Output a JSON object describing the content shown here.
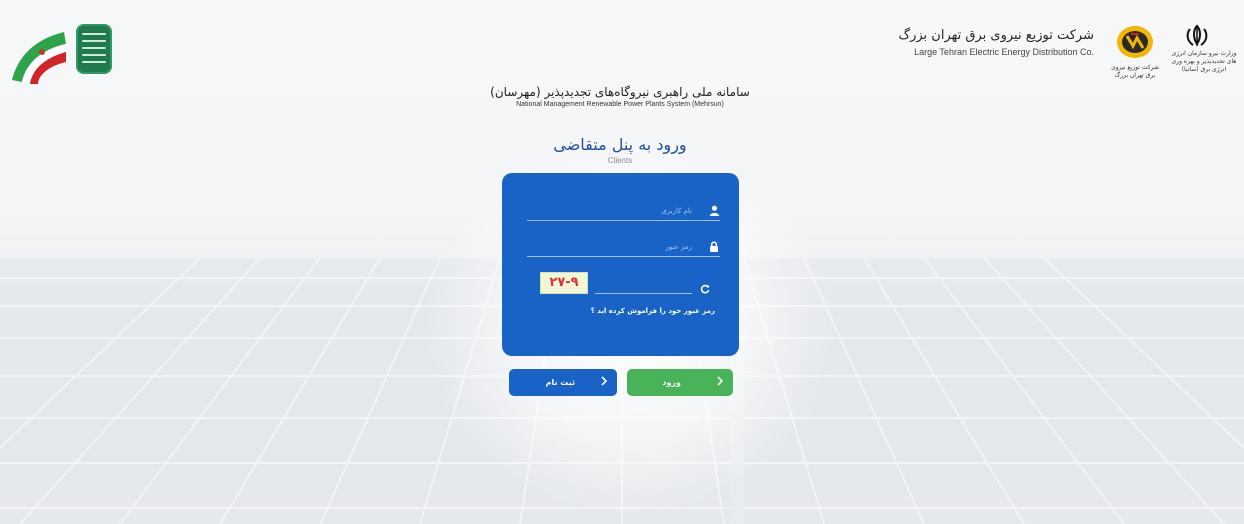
{
  "header": {
    "company_name_fa": "شرکت توزیع نیروی برق تهران بزرگ",
    "company_name_en": "Large Tehran Electric Energy Distribution Co.",
    "company_logo_caption": "شرکت توزیع نیروی برق تهران بزرگ",
    "ministry_caption": "وزارت نیرو سازمان انرژی های تجدیدپذیر و بهره وری انرژی برق (ساتبا)"
  },
  "system": {
    "title_fa": "سامانه ملی راهبری نیروگاه‌های تجدیدپذیر (مهرسان)",
    "title_en": "National Management Renewable Power Plants System (Mehrsun)"
  },
  "login": {
    "title_fa": "ورود به پنل متقاضی",
    "subtitle_en": "Clients",
    "username_placeholder": "نام کاربری",
    "password_placeholder": "رمز عبور",
    "captcha_text": "۲۷-۹",
    "forgot_link": "رمز عبور خود را فراموش کرده اید ؟",
    "login_button": "ورود",
    "register_button": "ثبت نام"
  },
  "icons": {
    "username": "user-icon",
    "password": "lock-icon",
    "captcha_refresh": "refresh-icon",
    "button_chevron": "chevron-right-icon"
  },
  "colors": {
    "card_blue": "#1963c7",
    "login_green": "#49b35a",
    "title_blue": "#1f4fa1"
  }
}
